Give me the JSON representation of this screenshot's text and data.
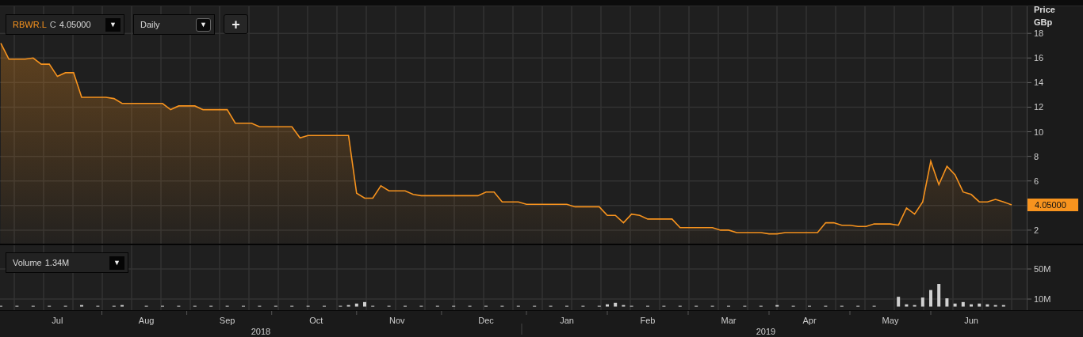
{
  "toolbar": {
    "symbol": "RBWR.L",
    "close_label": "C",
    "close_value": "4.05000",
    "symbol_arrow": "▼",
    "interval": "Daily",
    "interval_arrow": "▼",
    "add_button": "+"
  },
  "price_panel": {
    "axis_title": [
      "Price",
      "GBp"
    ],
    "last_price": "4.05000",
    "chart_data": {
      "type": "area",
      "grid": true,
      "ylim": [
        0.9,
        20.2
      ],
      "yticks": [
        2,
        6,
        8,
        10,
        12,
        14,
        16,
        18
      ],
      "categories": [
        null,
        null,
        null,
        null,
        null,
        null,
        null,
        null,
        null,
        null,
        null,
        null,
        null,
        null,
        null,
        null,
        null,
        null,
        null,
        null,
        null,
        null,
        null,
        null,
        null,
        null,
        null,
        null,
        null,
        null,
        null,
        null,
        null,
        null,
        null,
        null,
        null,
        null,
        null,
        null,
        null,
        null,
        null,
        null,
        null,
        null,
        null,
        null,
        null,
        null,
        null,
        null,
        null,
        null,
        null,
        null,
        null,
        null,
        null,
        null,
        null,
        null,
        null,
        null,
        null,
        null,
        null,
        null,
        null,
        null,
        null,
        null,
        null,
        null,
        null,
        null,
        null,
        null,
        null,
        null,
        null,
        null,
        null,
        null,
        null,
        null,
        null,
        null,
        null,
        null,
        null,
        null,
        null,
        null,
        null,
        null,
        null,
        null,
        null,
        null,
        null,
        null,
        null,
        null,
        null,
        null,
        null,
        null,
        null,
        null,
        null,
        null,
        null,
        null,
        null,
        null,
        null,
        null,
        null,
        null,
        null,
        null,
        null,
        null,
        null,
        null
      ],
      "series": [
        {
          "color": "#f7931e",
          "values": [
            17.2,
            15.9,
            15.9,
            15.9,
            16,
            15.5,
            15.5,
            14.5,
            14.8,
            14.8,
            12.8,
            12.8,
            12.8,
            12.8,
            12.7,
            12.3,
            12.3,
            12.3,
            12.3,
            12.3,
            12.3,
            11.8,
            12.1,
            12.1,
            12.1,
            11.8,
            11.8,
            11.8,
            11.8,
            10.7,
            10.7,
            10.7,
            10.4,
            10.4,
            10.4,
            10.4,
            10.4,
            9.5,
            9.7,
            9.7,
            9.7,
            9.7,
            9.7,
            9.7,
            5.0,
            4.6,
            4.6,
            5.6,
            5.2,
            5.2,
            5.2,
            4.9,
            4.8,
            4.8,
            4.8,
            4.8,
            4.8,
            4.8,
            4.8,
            4.8,
            5.1,
            5.1,
            4.3,
            4.3,
            4.3,
            4.1,
            4.1,
            4.1,
            4.1,
            4.1,
            4.1,
            3.9,
            3.9,
            3.9,
            3.9,
            3.2,
            3.2,
            2.6,
            3.3,
            3.2,
            2.9,
            2.9,
            2.9,
            2.9,
            2.2,
            2.2,
            2.2,
            2.2,
            2.2,
            2.0,
            2.0,
            1.8,
            1.8,
            1.8,
            1.8,
            1.7,
            1.7,
            1.8,
            1.8,
            1.8,
            1.8,
            1.8,
            2.6,
            2.6,
            2.4,
            2.4,
            2.3,
            2.3,
            2.5,
            2.5,
            2.5,
            2.4,
            3.8,
            3.3,
            4.3,
            7.6,
            5.7,
            7.2,
            6.5,
            5.1,
            4.9,
            4.3,
            4.3,
            4.5,
            4.3,
            4.05
          ]
        }
      ]
    }
  },
  "volume_panel": {
    "label": "Volume",
    "value": "1.34M",
    "arrow": "▼",
    "chart_data": {
      "type": "bar",
      "grid": true,
      "ylim": [
        -4.7,
        81.6
      ],
      "yticks": [
        {
          "value": 10,
          "label": "10M"
        },
        {
          "value": 50,
          "label": "50M"
        }
      ],
      "categories": [
        null,
        null,
        null,
        null,
        null,
        null,
        null,
        "Jul",
        null,
        null,
        null,
        null,
        null,
        null,
        null,
        null,
        null,
        null,
        "Aug",
        null,
        null,
        null,
        null,
        null,
        null,
        null,
        null,
        null,
        "Sep",
        null,
        null,
        null,
        null,
        null,
        null,
        null,
        null,
        null,
        null,
        "Oct",
        null,
        null,
        null,
        null,
        null,
        null,
        null,
        null,
        null,
        "Nov",
        null,
        null,
        null,
        null,
        null,
        null,
        null,
        null,
        null,
        null,
        "Dec",
        null,
        null,
        null,
        null,
        null,
        null,
        null,
        null,
        null,
        "Jan",
        null,
        null,
        null,
        null,
        null,
        null,
        null,
        null,
        null,
        "Feb",
        null,
        null,
        null,
        null,
        null,
        null,
        null,
        null,
        null,
        "Mar",
        null,
        null,
        null,
        null,
        null,
        null,
        null,
        null,
        null,
        "Apr",
        null,
        null,
        null,
        null,
        null,
        null,
        null,
        null,
        null,
        "May",
        null,
        null,
        null,
        null,
        null,
        null,
        null,
        null,
        null,
        "Jun",
        null,
        null,
        null,
        null,
        null
      ],
      "series": [
        {
          "color": "#d0d0d0",
          "values": [
            1,
            null,
            1,
            null,
            1,
            null,
            1,
            null,
            1,
            null,
            2,
            null,
            1,
            null,
            1,
            2,
            null,
            null,
            1,
            null,
            1,
            null,
            1,
            null,
            1,
            null,
            1,
            null,
            1,
            null,
            1,
            null,
            1,
            null,
            1,
            null,
            1,
            null,
            1,
            null,
            1,
            null,
            1,
            2,
            4,
            6,
            1,
            null,
            1,
            null,
            1,
            null,
            1,
            null,
            1,
            null,
            1,
            null,
            1,
            null,
            1,
            null,
            1,
            null,
            1,
            null,
            1,
            null,
            1,
            null,
            1,
            null,
            1,
            null,
            1,
            3,
            5,
            2,
            1,
            null,
            1,
            null,
            1,
            null,
            1,
            null,
            1,
            null,
            1,
            null,
            1,
            null,
            1,
            null,
            1,
            null,
            2,
            null,
            1,
            null,
            1,
            null,
            1,
            null,
            1,
            null,
            1,
            null,
            1,
            null,
            null,
            13,
            3,
            2,
            12,
            22,
            30,
            11,
            4,
            6,
            3,
            4,
            3,
            2,
            2,
            null
          ]
        }
      ]
    }
  },
  "time_axis": {
    "years": [
      "2018",
      "2019"
    ]
  }
}
